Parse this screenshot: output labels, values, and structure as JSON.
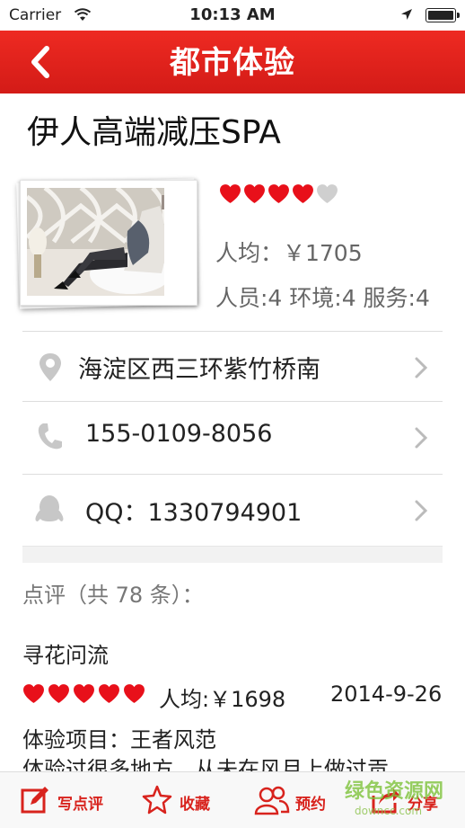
{
  "status_bar": {
    "carrier": "Carrier",
    "time": "10:13 AM"
  },
  "nav": {
    "title": "都市体验"
  },
  "shop": {
    "name": "伊人高端减压SPA",
    "rating_filled": 4,
    "rating_max": 5,
    "avg_price": "人均：￥1705",
    "sub_ratings": "人员:4  环境:4  服务:4"
  },
  "info_rows": [
    {
      "icon": "location-pin-icon",
      "text": "海淀区西三环紫竹桥南"
    },
    {
      "icon": "phone-icon",
      "text": "155-0109-8056"
    },
    {
      "icon": "qq-penguin-icon",
      "text": "QQ：1330794901"
    }
  ],
  "reviews": {
    "header": "点评（共 78 条）：",
    "items": [
      {
        "author": "寻花问流",
        "hearts": 5,
        "avg": "人均:￥1698",
        "date": "2014-9-26",
        "item": "体验项目：王者风范",
        "text": "体验过很多地方，从未在风月上做过贡"
      }
    ]
  },
  "tabbar": {
    "items": [
      {
        "icon": "write-review-icon",
        "label": "写点评"
      },
      {
        "icon": "star-icon",
        "label": "收藏"
      },
      {
        "icon": "people-icon",
        "label": "预约"
      },
      {
        "icon": "share-icon",
        "label": "分享"
      }
    ]
  },
  "watermark": {
    "text": "绿色资源网",
    "sub": "downcc.com"
  },
  "colors": {
    "accent": "#d8231d",
    "nav_bg": "#e12320",
    "heart": "#e8101a"
  }
}
